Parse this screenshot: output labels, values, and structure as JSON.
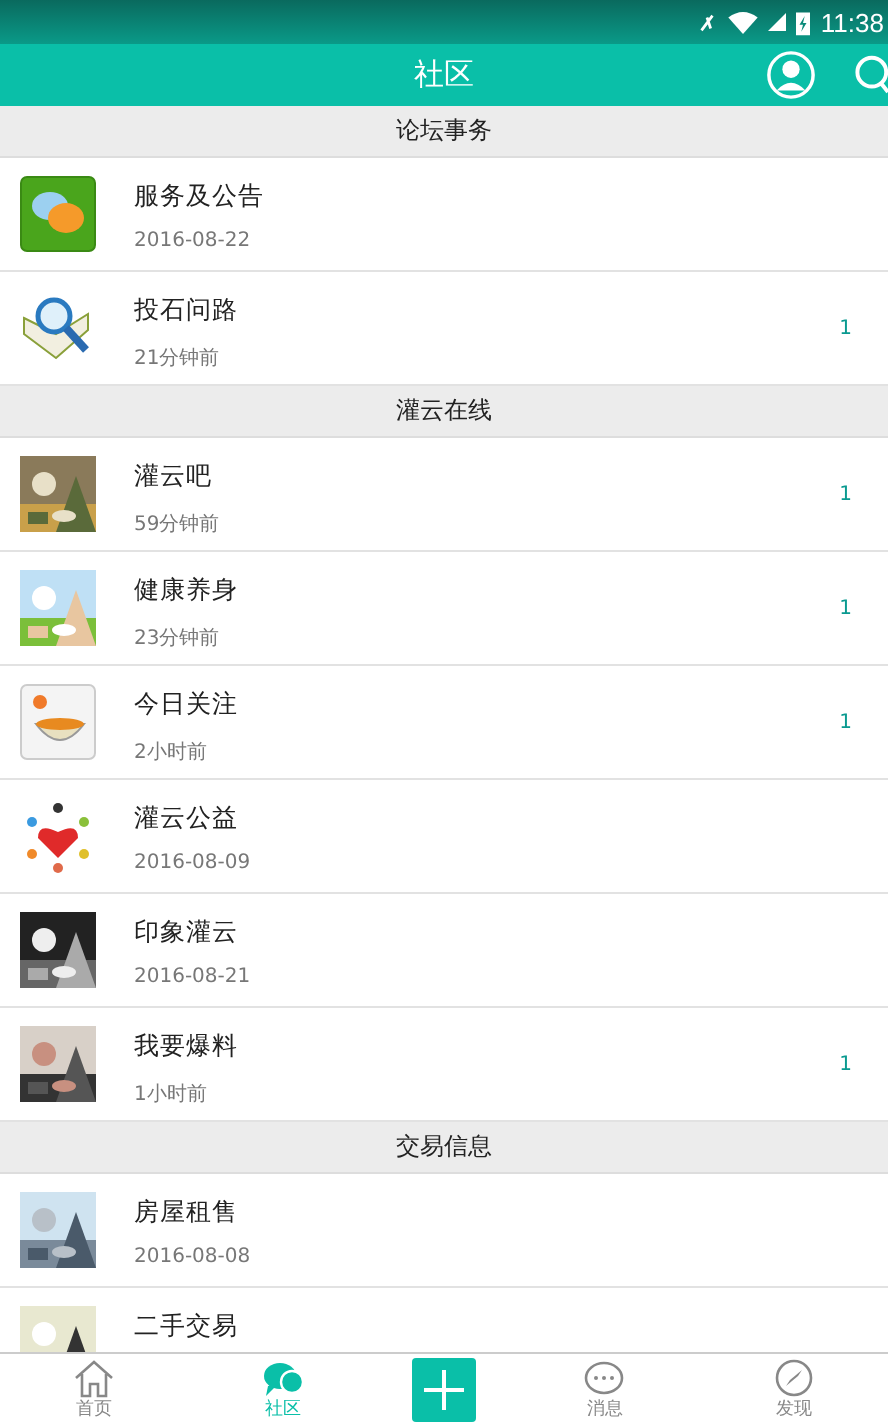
{
  "status_bar": {
    "time": "11:38"
  },
  "header": {
    "title": "社区"
  },
  "sections": [
    {
      "title": "论坛事务",
      "items": [
        {
          "name": "服务及公告",
          "time": "2016-08-22",
          "kind": "icon"
        },
        {
          "name": "投石问路",
          "time": "21分钟前",
          "kind": "icon",
          "count": "1"
        }
      ]
    },
    {
      "title": "灌云在线",
      "items": [
        {
          "name": "灌云吧",
          "time": "59分钟前",
          "kind": "picture",
          "count": "1"
        },
        {
          "name": "健康养身",
          "time": "23分钟前",
          "kind": "picture",
          "count": "1"
        },
        {
          "name": "今日关注",
          "time": "2小时前",
          "kind": "icon",
          "count": "1"
        },
        {
          "name": "灌云公益",
          "time": "2016-08-09",
          "kind": "icon"
        },
        {
          "name": "印象灌云",
          "time": "2016-08-21",
          "kind": "picture"
        },
        {
          "name": "我要爆料",
          "time": "1小时前",
          "kind": "picture",
          "count": "1"
        }
      ]
    },
    {
      "title": "交易信息",
      "items": [
        {
          "name": "房屋租售",
          "time": "2016-08-08",
          "kind": "picture"
        },
        {
          "name": "二手交易",
          "kind": "picture"
        }
      ]
    }
  ],
  "nav": [
    {
      "label": "首页",
      "selected": false
    },
    {
      "label": "社区",
      "selected": true
    },
    {
      "label": "消息",
      "selected": false
    },
    {
      "label": "发现",
      "selected": false
    }
  ]
}
